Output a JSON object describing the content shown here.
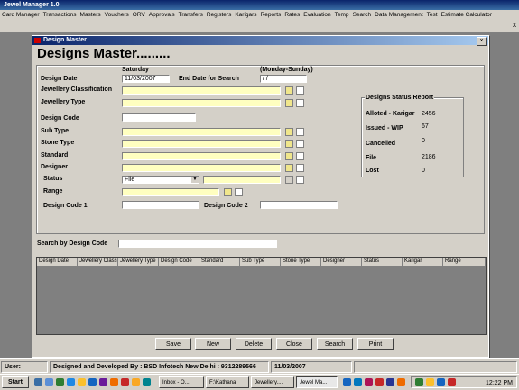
{
  "app": {
    "title": "Jewel Manager 1.0",
    "menu": [
      "Card Manager",
      "Transactions",
      "Masters",
      "Vouchers",
      "ORV",
      "Approvals",
      "Transfers",
      "Registers",
      "Karigars",
      "Reports",
      "Rates",
      "Evaluation",
      "Temp",
      "Search",
      "Data Management",
      "Test",
      "Estimate Calculator"
    ],
    "close_glyph": "x"
  },
  "window": {
    "title": "Design Master",
    "heading": "Designs Master.........",
    "close_glyph": "×"
  },
  "form": {
    "day": "Saturday",
    "week_hint": "(Monday-Sunday)",
    "design_date_label": "Design Date",
    "design_date_value": "11/03/2007",
    "end_date_label": "End Date for Search",
    "end_date_value": "/ /",
    "jewellery_classification_label": "Jewellery Classification",
    "jewellery_type_label": "Jewellery Type",
    "design_code_label": "Design Code",
    "sub_type_label": "Sub Type",
    "stone_type_label": "Stone Type",
    "standard_label": "Standard",
    "designer_label": "Designer",
    "status_label": "Status",
    "status_value": "File",
    "range_label": "Range",
    "design_code_1_label": "Design Code 1",
    "design_code_2_label": "Design Code 2"
  },
  "status_report": {
    "title": "Designs Status Report",
    "rows": [
      {
        "label": "Alloted - Karigar",
        "value": "2456"
      },
      {
        "label": "Issued - WIP",
        "value": "67"
      },
      {
        "label": "Cancelled",
        "value": "0"
      },
      {
        "label": "File",
        "value": "2186"
      },
      {
        "label": "Lost",
        "value": "0"
      }
    ]
  },
  "search": {
    "label": "Search by Design Code"
  },
  "grid": {
    "columns": [
      "Design Date",
      "Jewellery Classi",
      "Jewellery Type",
      "Design Code",
      "Standard",
      "Sub Type",
      "Stone Type",
      "Designer",
      "Status",
      "Karigar",
      "Range"
    ]
  },
  "buttons": {
    "save": "Save",
    "new": "New",
    "delete": "Delete",
    "close": "Close",
    "search": "Search",
    "print": "Print"
  },
  "statusbar": {
    "user_label": "User:",
    "credit": "Designed and Developed By : BSD Infotech New Delhi : 9312289566",
    "date": "11/03/2007"
  },
  "taskbar": {
    "start": "Start",
    "tasks": [
      "Inbox - O...",
      "F:\\Kathana",
      "Jewellery....",
      "Jewel Ma..."
    ],
    "clock": "12:22 PM"
  },
  "colors": {
    "field_yellow": "#ffffc0",
    "titlebar_blue": "#0a246a",
    "face_gray": "#d4d0c8"
  }
}
